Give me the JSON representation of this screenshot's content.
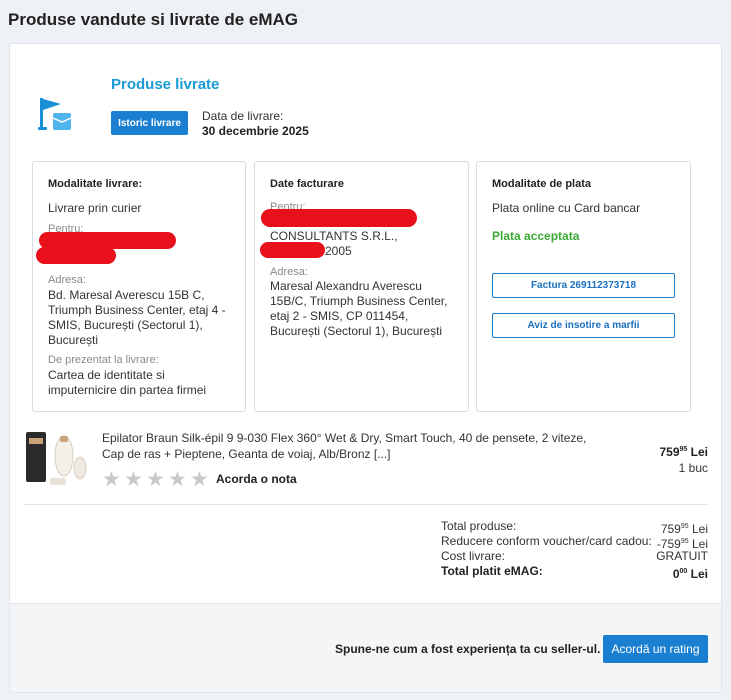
{
  "page_title": "Produse vandute si livrate de eMAG",
  "section": {
    "title": "Produse livrate",
    "history_button": "Istoric livrare",
    "delivery_date_label": "Data de livrare:",
    "delivery_date_value": "30 decembrie 2025"
  },
  "delivery": {
    "heading": "Modalitate livrare:",
    "method": "Livrare prin curier",
    "for_label": "Pentru:",
    "address_label": "Adresa:",
    "address": "Bd. Maresal Averescu 15B C, Triumph Business Center, etaj 4 - SMIS, București (Sectorul 1), București",
    "present_label": "De prezentat la livrare:",
    "present_value": "Cartea de identitate si imputernicire din partea firmei"
  },
  "billing": {
    "heading": "Date facturare",
    "for_label": "Pentru:",
    "company": "CONSULTANTS S.R.L.,",
    "code_suffix": "2005",
    "address_label": "Adresa:",
    "address": "Maresal Alexandru Averescu 15B/C, Triumph Business Center, etaj 2 - SMIS, CP 011454, București (Sectorul 1), București"
  },
  "payment": {
    "heading": "Modalitate de plata",
    "method": "Plata online cu Card bancar",
    "status": "Plata acceptata",
    "invoice_button": "Factura 269112373718",
    "shipping_notice_button": "Aviz de insotire a marfii",
    "status_color": "#3aaa35"
  },
  "product": {
    "name": "Epilator Braun Silk-épil 9 9-030 Flex 360° Wet & Dry, Smart Touch, 40 de pensete, 2 viteze, Cap de ras + Pieptene, Geanta de voiaj, Alb/Bronz [...]",
    "price_int": "759",
    "price_dec": "95",
    "currency": "Lei",
    "quantity": "1 buc",
    "rate_label": "Acorda o nota",
    "rating": 0,
    "rating_max": 5
  },
  "totals": {
    "products_label": "Total produse:",
    "products_int": "759",
    "products_dec": "95",
    "discount_label": "Reducere conform voucher/card cadou:",
    "discount_int": "-759",
    "discount_dec": "95",
    "shipping_label": "Cost livrare:",
    "shipping_value": "GRATUIT",
    "total_label": "Total platit eMAG:",
    "total_int": "0",
    "total_dec": "00",
    "currency": "Lei"
  },
  "footer": {
    "prompt": "Spune-ne cum a fost experiența ta cu seller-ul.",
    "rating_button": "Acordă un rating"
  },
  "colors": {
    "accent": "#1a7fd0",
    "title_blue": "#1a9ad6",
    "redaction": "#e8101a"
  }
}
